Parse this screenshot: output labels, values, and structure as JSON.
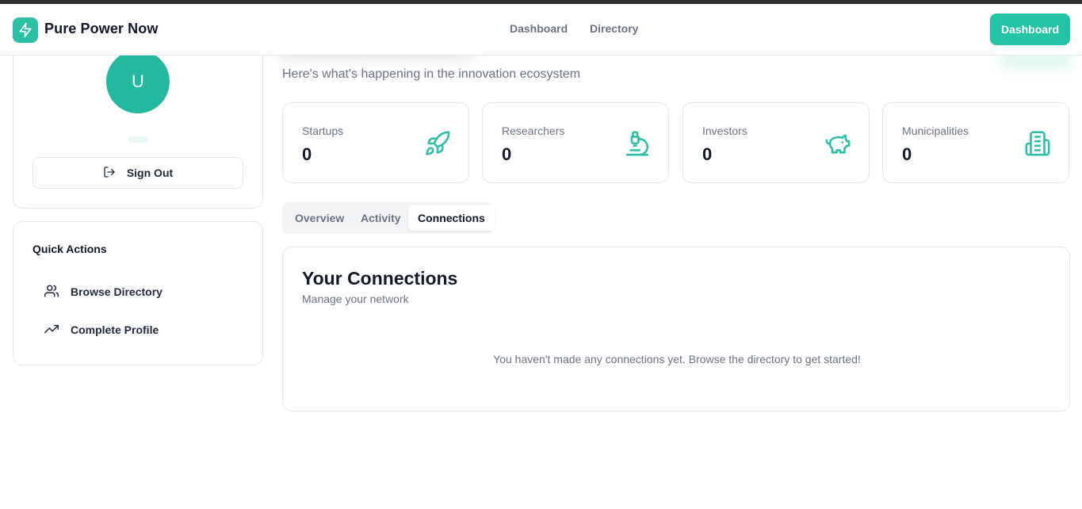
{
  "header": {
    "brand": "Pure Power Now",
    "logo_icon": "zap-icon",
    "nav": [
      {
        "label": "Dashboard"
      },
      {
        "label": "Directory"
      }
    ],
    "cta_label": "Dashboard"
  },
  "profile": {
    "avatar_initial": "U",
    "sign_out_label": "Sign Out",
    "sign_out_icon": "log-out-icon"
  },
  "quick_actions": {
    "title": "Quick Actions",
    "items": [
      {
        "label": "Browse Directory",
        "icon": "users-icon"
      },
      {
        "label": "Complete Profile",
        "icon": "trending-up-icon"
      }
    ]
  },
  "main": {
    "subtitle": "Here's what's happening in the innovation ecosystem",
    "stats": [
      {
        "label": "Startups",
        "value": "0",
        "icon": "rocket-icon"
      },
      {
        "label": "Researchers",
        "value": "0",
        "icon": "microscope-icon"
      },
      {
        "label": "Investors",
        "value": "0",
        "icon": "piggy-bank-icon"
      },
      {
        "label": "Municipalities",
        "value": "0",
        "icon": "building-icon"
      }
    ],
    "tabs": [
      {
        "label": "Overview"
      },
      {
        "label": "Activity"
      },
      {
        "label": "Connections",
        "active": true
      }
    ],
    "connections": {
      "title": "Your Connections",
      "subtitle": "Manage your network",
      "empty_message": "You haven't made any connections yet. Browse the directory to get started!"
    }
  },
  "colors": {
    "accent": "#25c3a6",
    "avatar": "#24b89e",
    "icon": "#2dbfa5"
  }
}
